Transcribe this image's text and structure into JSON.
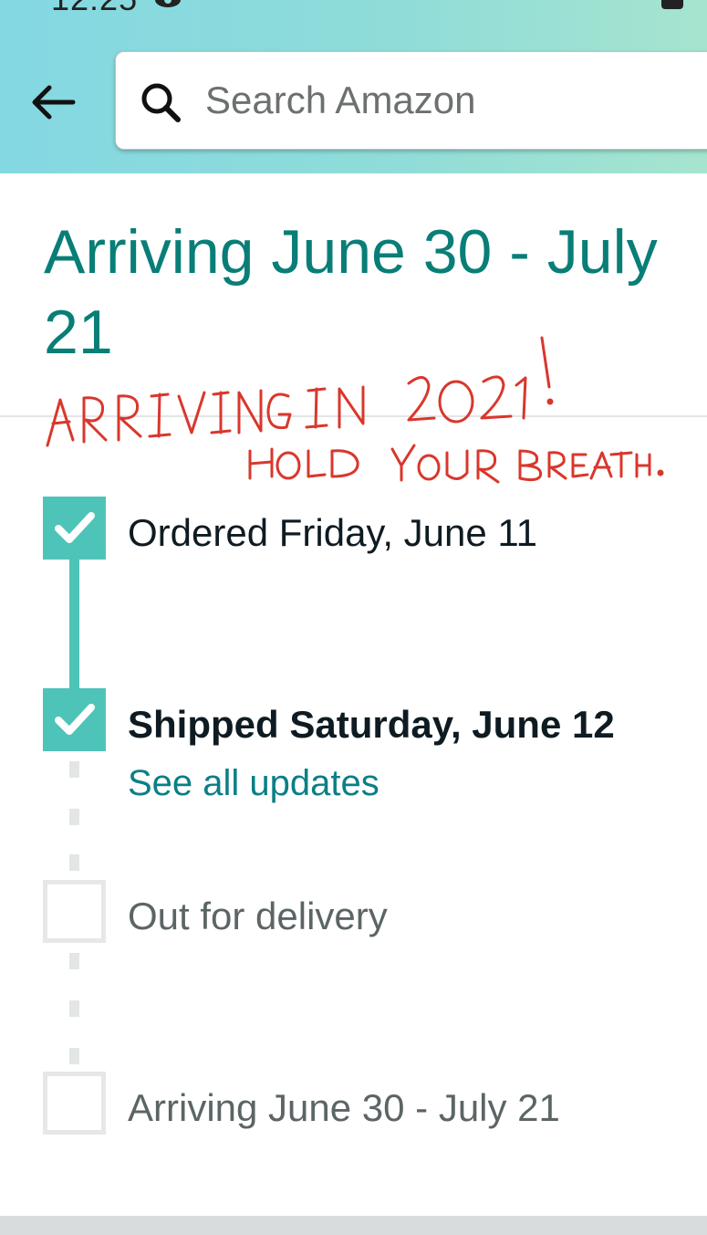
{
  "status_bar": {
    "time": "12:25"
  },
  "search": {
    "placeholder": "Search Amazon",
    "value": ""
  },
  "delivery": {
    "title": "Arriving June 30 - July 21"
  },
  "annotation": {
    "line1": "ARRIVING IN 2021!",
    "line2": "HOLD YOUR BREATH.",
    "color": "#d9372c"
  },
  "tracking": {
    "steps": [
      {
        "label": "Ordered Friday, June 11",
        "status": "complete"
      },
      {
        "label": "Shipped Saturday, June 12",
        "status": "complete",
        "link": "See all updates"
      },
      {
        "label": "Out for delivery",
        "status": "pending"
      },
      {
        "label": "Arriving June 30 - July 21",
        "status": "pending"
      }
    ]
  },
  "colors": {
    "accent_teal": "#087e77",
    "check_fill": "#4ec4b8",
    "link": "#0a7f86",
    "header_gradient_start": "#84d8e2",
    "header_gradient_end": "#a6e4cf"
  },
  "icons": [
    "eye-icon",
    "status-icon",
    "back-arrow-icon",
    "search-icon",
    "checkmark-icon"
  ]
}
